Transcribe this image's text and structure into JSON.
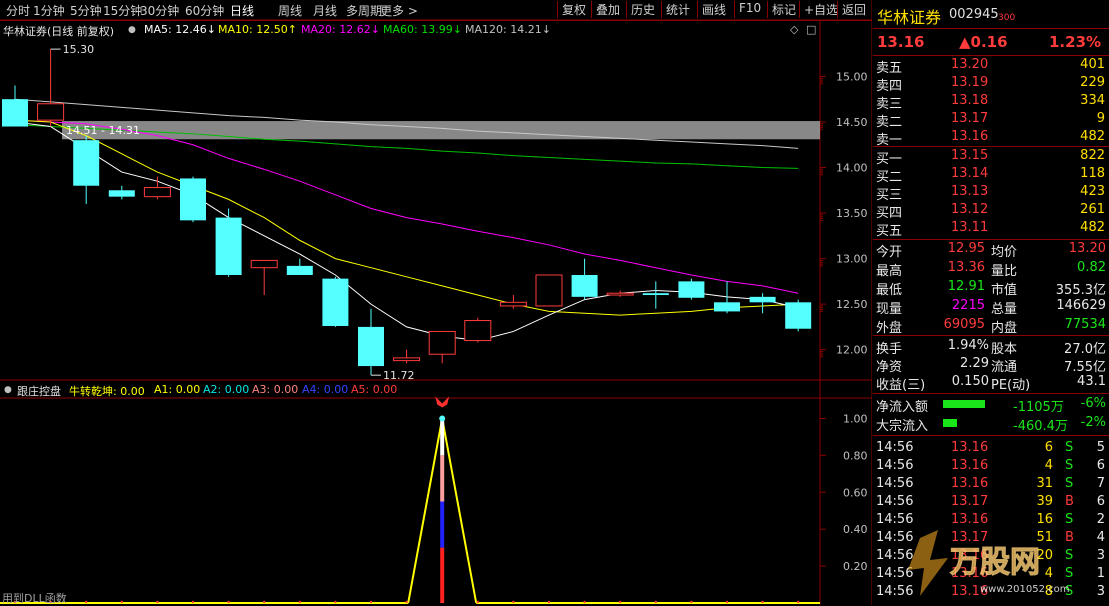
{
  "toolbar": {
    "periods": [
      "分时",
      "1分钟",
      "5分钟",
      "15分钟",
      "30分钟",
      "60分钟",
      "日线",
      "周线",
      "月线",
      "多周期",
      "更多 >"
    ],
    "active_period": "日线",
    "buttons": [
      "复权",
      "叠加",
      "历史",
      "统计",
      "画线",
      "F10",
      "标记",
      "+自选",
      "返回"
    ]
  },
  "chart_legend": {
    "title": "华林证券(日线 前复权)",
    "ma5": "MA5: 12.46↓",
    "ma10": "MA10: 12.50↑",
    "ma20": "MA20: 12.62↓",
    "ma60": "MA60: 13.99↓",
    "ma120": "MA120: 14.21↓",
    "colors": {
      "ma5": "#ffffff",
      "ma10": "#ffff00",
      "ma20": "#ff00ff",
      "ma60": "#00cc00",
      "ma120": "#c0c0c0"
    }
  },
  "price_axis": [
    "15.00",
    "14.50",
    "14.00",
    "13.50",
    "13.00",
    "12.50",
    "12.00"
  ],
  "annotations": {
    "high": "15.30",
    "low": "11.72",
    "range": "14.51 - 14.31"
  },
  "sub_legend": {
    "name": "跟庄控盘",
    "items": [
      "牛转乾坤: 0.00",
      "A1: 0.00",
      "A2: 0.00",
      "A3: 0.00",
      "A4: 0.00",
      "A5: 0.00"
    ],
    "footer": "用到DLL函数"
  },
  "sub_axis": [
    "1.00",
    "0.80",
    "0.60",
    "0.40",
    "0.20"
  ],
  "chart_data": {
    "type": "candlestick",
    "ylim": [
      11.7,
      15.4
    ],
    "candles": [
      {
        "o": 14.75,
        "h": 14.9,
        "l": 14.5,
        "c": 14.45
      },
      {
        "o": 14.52,
        "h": 15.3,
        "l": 14.45,
        "c": 14.7
      },
      {
        "o": 14.3,
        "h": 14.35,
        "l": 13.6,
        "c": 13.8
      },
      {
        "o": 13.75,
        "h": 13.8,
        "l": 13.65,
        "c": 13.68
      },
      {
        "o": 13.68,
        "h": 13.9,
        "l": 13.65,
        "c": 13.78
      },
      {
        "o": 13.88,
        "h": 13.9,
        "l": 13.4,
        "c": 13.42
      },
      {
        "o": 13.45,
        "h": 13.55,
        "l": 12.8,
        "c": 12.82
      },
      {
        "o": 12.9,
        "h": 12.95,
        "l": 12.6,
        "c": 12.98
      },
      {
        "o": 12.92,
        "h": 13.0,
        "l": 12.85,
        "c": 12.82
      },
      {
        "o": 12.78,
        "h": 12.8,
        "l": 12.25,
        "c": 12.26
      },
      {
        "o": 12.25,
        "h": 12.45,
        "l": 11.72,
        "c": 11.82
      },
      {
        "o": 11.88,
        "h": 12.0,
        "l": 11.85,
        "c": 11.91
      },
      {
        "o": 11.95,
        "h": 12.2,
        "l": 11.85,
        "c": 12.2
      },
      {
        "o": 12.1,
        "h": 12.35,
        "l": 12.08,
        "c": 12.32
      },
      {
        "o": 12.48,
        "h": 12.6,
        "l": 12.45,
        "c": 12.52
      },
      {
        "o": 12.48,
        "h": 12.8,
        "l": 12.48,
        "c": 12.82
      },
      {
        "o": 12.82,
        "h": 13.0,
        "l": 12.55,
        "c": 12.58
      },
      {
        "o": 12.6,
        "h": 12.65,
        "l": 12.58,
        "c": 12.62
      },
      {
        "o": 12.62,
        "h": 12.75,
        "l": 12.45,
        "c": 12.6
      },
      {
        "o": 12.75,
        "h": 12.78,
        "l": 12.55,
        "c": 12.57
      },
      {
        "o": 12.52,
        "h": 12.75,
        "l": 12.4,
        "c": 12.42
      },
      {
        "o": 12.58,
        "h": 12.62,
        "l": 12.4,
        "c": 12.52
      },
      {
        "o": 12.52,
        "h": 12.55,
        "l": 12.2,
        "c": 12.23
      }
    ],
    "ma5": [
      14.5,
      14.45,
      14.2,
      13.95,
      13.85,
      13.7,
      13.45,
      13.25,
      13.05,
      12.82,
      12.5,
      12.25,
      12.15,
      12.1,
      12.2,
      12.38,
      12.55,
      12.62,
      12.65,
      12.63,
      12.58,
      12.55,
      12.46
    ],
    "ma10": [
      14.52,
      14.5,
      14.35,
      14.15,
      13.95,
      13.8,
      13.65,
      13.45,
      13.2,
      13.0,
      12.9,
      12.8,
      12.7,
      12.6,
      12.5,
      12.42,
      12.4,
      12.38,
      12.4,
      12.42,
      12.46,
      12.48,
      12.5
    ],
    "ma20": [
      14.52,
      14.5,
      14.48,
      14.42,
      14.35,
      14.25,
      14.1,
      13.98,
      13.85,
      13.7,
      13.55,
      13.45,
      13.38,
      13.3,
      13.23,
      13.15,
      13.05,
      12.98,
      12.9,
      12.82,
      12.75,
      12.7,
      12.62
    ],
    "ma60": [
      14.47,
      14.45,
      14.43,
      14.41,
      14.39,
      14.37,
      14.34,
      14.31,
      14.29,
      14.26,
      14.23,
      14.21,
      14.18,
      14.16,
      14.13,
      14.11,
      14.09,
      14.07,
      14.05,
      14.04,
      14.02,
      14.0,
      13.99
    ],
    "ma120": [
      14.75,
      14.72,
      14.69,
      14.66,
      14.63,
      14.6,
      14.57,
      14.55,
      14.52,
      14.5,
      14.47,
      14.45,
      14.43,
      14.4,
      14.38,
      14.36,
      14.34,
      14.32,
      14.3,
      14.28,
      14.26,
      14.24,
      14.21
    ],
    "indicator": {
      "spike_index": 12,
      "spike_value": 1.0,
      "base_value": 0.0,
      "ylim": [
        0,
        1.1
      ]
    }
  },
  "quote": {
    "name": "华林证券",
    "code": "002945",
    "code_suffix": "300",
    "price": "13.16",
    "change": "▲0.16",
    "pct": "1.23%",
    "asks": [
      {
        "label": "卖五",
        "price": "13.20",
        "vol": "401"
      },
      {
        "label": "卖四",
        "price": "13.19",
        "vol": "229"
      },
      {
        "label": "卖三",
        "price": "13.18",
        "vol": "334"
      },
      {
        "label": "卖二",
        "price": "13.17",
        "vol": "9"
      },
      {
        "label": "卖一",
        "price": "13.16",
        "vol": "482"
      }
    ],
    "bids": [
      {
        "label": "买一",
        "price": "13.15",
        "vol": "822"
      },
      {
        "label": "买二",
        "price": "13.14",
        "vol": "118"
      },
      {
        "label": "买三",
        "price": "13.13",
        "vol": "423"
      },
      {
        "label": "买四",
        "price": "13.12",
        "vol": "261"
      },
      {
        "label": "买五",
        "price": "13.11",
        "vol": "482"
      }
    ],
    "stats": [
      {
        "l1": "今开",
        "v1": "12.95",
        "c1": "red",
        "l2": "均价",
        "v2": "13.20",
        "c2": "red"
      },
      {
        "l1": "最高",
        "v1": "13.36",
        "c1": "red",
        "l2": "量比",
        "v2": "0.82",
        "c2": "green"
      },
      {
        "l1": "最低",
        "v1": "12.91",
        "c1": "green",
        "l2": "市值",
        "v2": "355.3亿",
        "c2": "white"
      },
      {
        "l1": "现量",
        "v1": "2215",
        "c1": "mag",
        "l2": "总量",
        "v2": "146629",
        "c2": "white"
      },
      {
        "l1": "外盘",
        "v1": "69095",
        "c1": "red",
        "l2": "内盘",
        "v2": "77534",
        "c2": "green"
      }
    ],
    "fund": [
      {
        "l1": "换手",
        "v1": "1.94%",
        "l2": "股本",
        "v2": "27.0亿"
      },
      {
        "l1": "净资",
        "v1": "2.29",
        "l2": "流通",
        "v2": "7.55亿"
      },
      {
        "l1": "收益(三)",
        "v1": "0.150",
        "l2": "PE(动)",
        "v2": "43.1"
      }
    ],
    "flows": [
      {
        "label": "净流入额",
        "value": "-1105万",
        "pct": "-6%",
        "bar": 0.75
      },
      {
        "label": "大宗流入",
        "value": "-460.4万",
        "pct": "-2%",
        "bar": 0.25
      }
    ],
    "ticks": [
      {
        "t": "14:56",
        "p": "13.16",
        "v": "6",
        "s": "S",
        "n": "5"
      },
      {
        "t": "14:56",
        "p": "13.16",
        "v": "4",
        "s": "S",
        "n": "6"
      },
      {
        "t": "14:56",
        "p": "13.16",
        "v": "31",
        "s": "S",
        "n": "7"
      },
      {
        "t": "14:56",
        "p": "13.17",
        "v": "39",
        "s": "B",
        "n": "6"
      },
      {
        "t": "14:56",
        "p": "13.16",
        "v": "16",
        "s": "S",
        "n": "2"
      },
      {
        "t": "14:56",
        "p": "13.17",
        "v": "51",
        "s": "B",
        "n": "4"
      },
      {
        "t": "14:56",
        "p": "13.16",
        "v": "20",
        "s": "S",
        "n": "3"
      },
      {
        "t": "14:56",
        "p": "13.16",
        "v": "4",
        "s": "S",
        "n": "1"
      },
      {
        "t": "14:56",
        "p": "13.16",
        "v": "8",
        "s": "S",
        "n": "3"
      }
    ]
  },
  "watermark": {
    "text": "万股网",
    "url": "www.201052.com"
  }
}
